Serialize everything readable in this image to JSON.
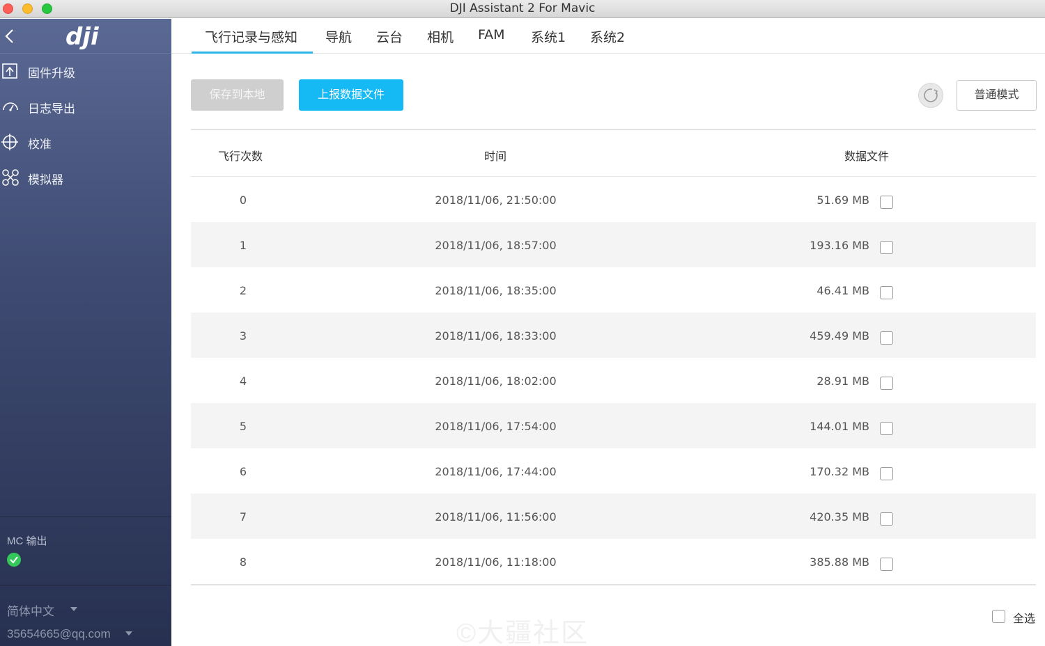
{
  "window": {
    "title": "DJI Assistant 2 For Mavic"
  },
  "sidebar": {
    "logo_text": "dji",
    "items": [
      {
        "label": "固件升级",
        "icon": "firmware-update-icon"
      },
      {
        "label": "日志导出",
        "icon": "log-export-icon"
      },
      {
        "label": "校准",
        "icon": "calibration-icon"
      },
      {
        "label": "模拟器",
        "icon": "simulator-drone-icon"
      }
    ],
    "mc_output_label": "MC 输出",
    "language": "简体中文",
    "account": "35654665@qq.com"
  },
  "tabs": [
    {
      "label": "飞行记录与感知",
      "active": true
    },
    {
      "label": "导航"
    },
    {
      "label": "云台"
    },
    {
      "label": "相机"
    },
    {
      "label": "FAM"
    },
    {
      "label": "系统1"
    },
    {
      "label": "系统2"
    }
  ],
  "toolbar": {
    "save_label": "保存到本地",
    "upload_label": "上报数据文件",
    "mode_label": "普通模式"
  },
  "table": {
    "headers": {
      "count": "飞行次数",
      "time": "时间",
      "file": "数据文件"
    },
    "rows": [
      {
        "num": "0",
        "time": "2018/11/06, 21:50:00",
        "size": "51.69 MB"
      },
      {
        "num": "1",
        "time": "2018/11/06, 18:57:00",
        "size": "193.16 MB"
      },
      {
        "num": "2",
        "time": "2018/11/06, 18:35:00",
        "size": "46.41 MB"
      },
      {
        "num": "3",
        "time": "2018/11/06, 18:33:00",
        "size": "459.49 MB"
      },
      {
        "num": "4",
        "time": "2018/11/06, 18:02:00",
        "size": "28.91 MB"
      },
      {
        "num": "5",
        "time": "2018/11/06, 17:54:00",
        "size": "144.01 MB"
      },
      {
        "num": "6",
        "time": "2018/11/06, 17:44:00",
        "size": "170.32 MB"
      },
      {
        "num": "7",
        "time": "2018/11/06, 11:56:00",
        "size": "420.35 MB"
      },
      {
        "num": "8",
        "time": "2018/11/06, 11:18:00",
        "size": "385.88 MB"
      }
    ]
  },
  "select_all_label": "全选",
  "watermark": "©大疆社区",
  "colors": {
    "accent": "#15b9f4",
    "tab_underline": "#2bb5e8",
    "ok": "#34c759"
  }
}
